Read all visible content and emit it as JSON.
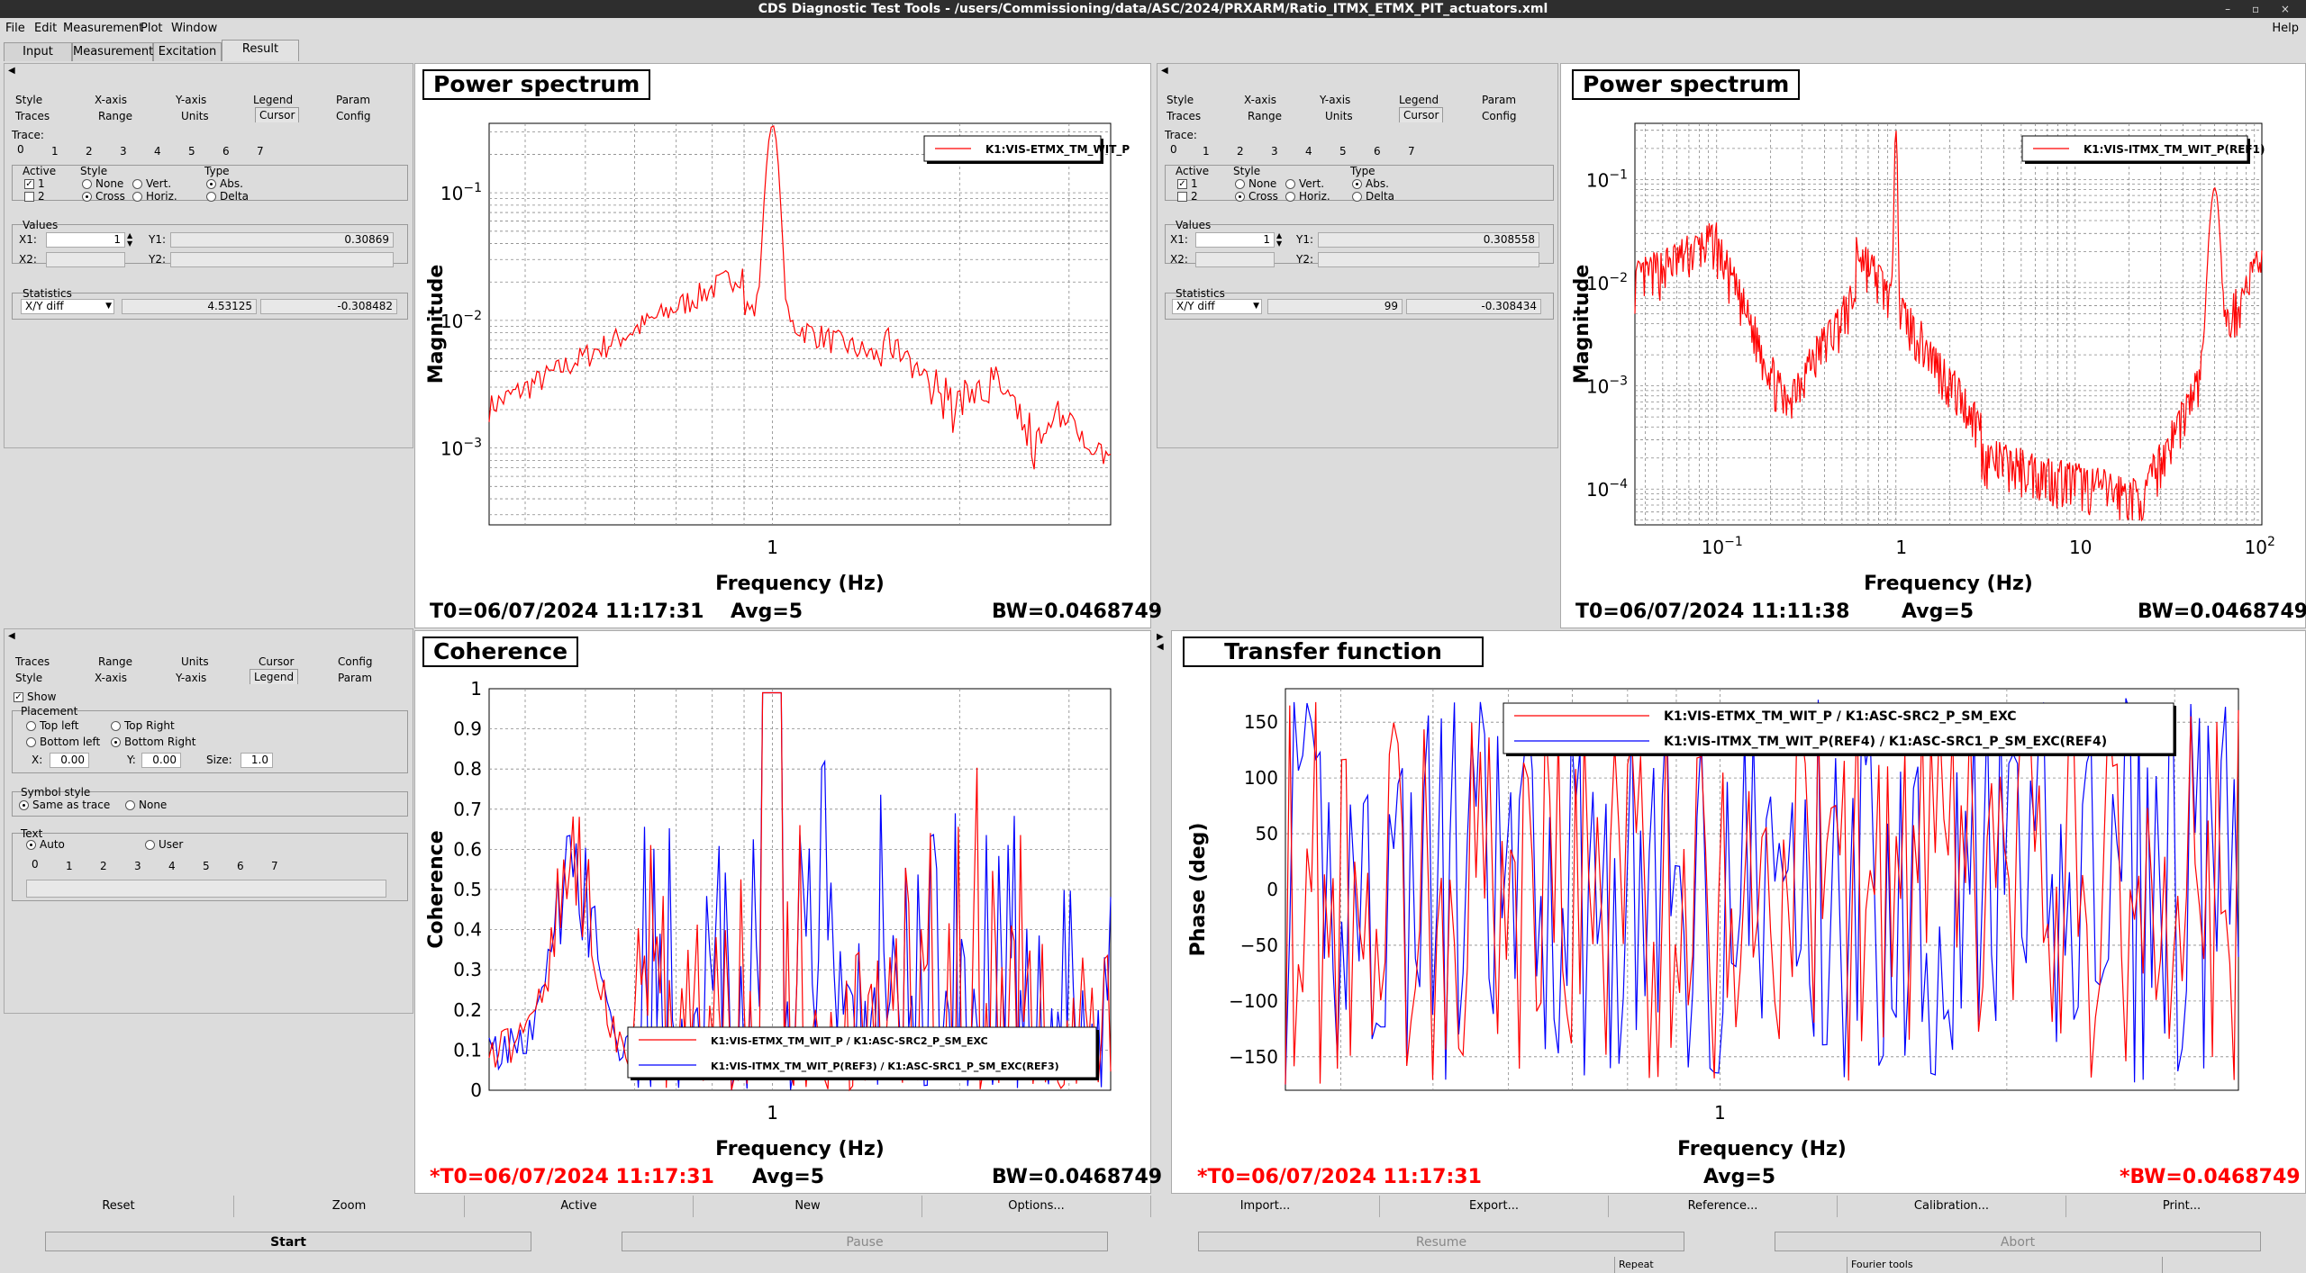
{
  "window": {
    "title": "CDS Diagnostic Test Tools - /users/Commissioning/data/ASC/2024/PRXARM/Ratio_ITMX_ETMX_PIT_actuators.xml",
    "controls": "– ▫ ×"
  },
  "menu": [
    "File",
    "Edit",
    "Measurement",
    "Plot",
    "Window"
  ],
  "help": "Help",
  "main_tabs": [
    "Input",
    "Measurement",
    "Excitation",
    "Result"
  ],
  "cursor_panel_1": {
    "tabs_row1": [
      "Style",
      "X-axis",
      "Y-axis",
      "Legend",
      "Param"
    ],
    "tabs_row2": [
      "Traces",
      "Range",
      "Units",
      "Cursor",
      "Config"
    ],
    "trace_label": "Trace:",
    "trace_nums": [
      "0",
      "1",
      "2",
      "3",
      "4",
      "5",
      "6",
      "7"
    ],
    "active_label": "Active",
    "active_1": "1",
    "active_2": "2",
    "style_label": "Style",
    "style_none": "None",
    "style_cross": "Cross",
    "style_vert": "Vert.",
    "style_horiz": "Horiz.",
    "type_label": "Type",
    "type_abs": "Abs.",
    "type_delta": "Delta",
    "values_label": "Values",
    "x1_label": "X1:",
    "x1_value": "1",
    "y1_label": "Y1:",
    "y1_value": "0.30869",
    "x2_label": "X2:",
    "y2_label": "Y2:",
    "stats_label": "Statistics",
    "stats_select": "X/Y diff",
    "stats_v1": "4.53125",
    "stats_v2": "-0.308482"
  },
  "cursor_panel_2": {
    "x1_value": "1",
    "y1_value": "0.308558",
    "stats_select": "X/Y diff",
    "stats_v1": "99",
    "stats_v2": "-0.308434"
  },
  "legend_panel": {
    "tabs_row1": [
      "Traces",
      "Range",
      "Units",
      "Cursor",
      "Config"
    ],
    "tabs_row2": [
      "Style",
      "X-axis",
      "Y-axis",
      "Legend",
      "Param"
    ],
    "show": "Show",
    "placement_label": "Placement",
    "top_left": "Top left",
    "top_right": "Top Right",
    "bottom_left": "Bottom left",
    "bottom_right": "Bottom Right",
    "x_label": "X:",
    "x_value": "0.00",
    "y_label": "Y:",
    "y_value": "0.00",
    "size_label": "Size:",
    "size_value": "1.0",
    "symbol_label": "Symbol style",
    "same_as_trace": "Same as trace",
    "none": "None",
    "text_label": "Text",
    "auto": "Auto",
    "user": "User",
    "nums": [
      "0",
      "1",
      "2",
      "3",
      "4",
      "5",
      "6",
      "7"
    ]
  },
  "plots": {
    "p1": {
      "title": "Power spectrum",
      "ylabel": "Magnitude",
      "xlabel": "Frequency (Hz)",
      "legend": "K1:VIS-ETMX_TM_WIT_P",
      "yticks": [
        "10",
        "10",
        "10"
      ],
      "yexps": [
        "−1",
        "−2",
        "−3"
      ],
      "xticks": [
        "1"
      ],
      "t0": "T0=06/07/2024 11:17:31",
      "avg": "Avg=5",
      "bw": "BW=0.0468749"
    },
    "p2": {
      "title": "Power spectrum",
      "ylabel": "Magnitude",
      "xlabel": "Frequency (Hz)",
      "legend": "K1:VIS-ITMX_TM_WIT_P(REF1)",
      "yticks": [
        "10",
        "10",
        "10",
        "10"
      ],
      "yexps": [
        "−1",
        "−2",
        "−3",
        "−4"
      ],
      "xticks": [
        "10",
        "1",
        "10",
        "10"
      ],
      "xexps": [
        "−1",
        "",
        "",
        "2"
      ],
      "t0": "T0=06/07/2024 11:11:38",
      "avg": "Avg=5",
      "bw": "BW=0.0468749"
    },
    "p3": {
      "title": "Coherence",
      "ylabel": "Coherence",
      "xlabel": "Frequency (Hz)",
      "legend1": "K1:VIS-ETMX_TM_WIT_P / K1:ASC-SRC2_P_SM_EXC",
      "legend2": "K1:VIS-ITMX_TM_WIT_P(REF3) / K1:ASC-SRC1_P_SM_EXC(REF3)",
      "yticks": [
        "1",
        "0.9",
        "0.8",
        "0.7",
        "0.6",
        "0.5",
        "0.4",
        "0.3",
        "0.2",
        "0.1",
        "0"
      ],
      "xticks": [
        "1"
      ],
      "t0": "*T0=06/07/2024 11:17:31",
      "avg": "Avg=5",
      "bw": "BW=0.0468749"
    },
    "p4": {
      "title": "Transfer function",
      "ylabel": "Phase (deg)",
      "xlabel": "Frequency (Hz)",
      "legend1": "K1:VIS-ETMX_TM_WIT_P / K1:ASC-SRC2_P_SM_EXC",
      "legend2": "K1:VIS-ITMX_TM_WIT_P(REF4) / K1:ASC-SRC1_P_SM_EXC(REF4)",
      "yticks": [
        "150",
        "100",
        "50",
        "0",
        "−50",
        "−100",
        "−150"
      ],
      "xticks": [
        "1"
      ],
      "t0": "*T0=06/07/2024 11:17:31",
      "avg": "Avg=5",
      "bw": "*BW=0.0468749"
    }
  },
  "colors": {
    "trace_red": "#ff0000",
    "trace_blue": "#0000ff",
    "alert_red": "#ff0000"
  },
  "buttons": [
    "Reset",
    "Zoom",
    "Active",
    "New",
    "Options...",
    "Import...",
    "Export...",
    "Reference...",
    "Calibration...",
    "Print..."
  ],
  "run_buttons": [
    "Start",
    "Pause",
    "Resume",
    "Abort"
  ],
  "status": [
    "Repeat",
    "Fourier tools"
  ]
}
